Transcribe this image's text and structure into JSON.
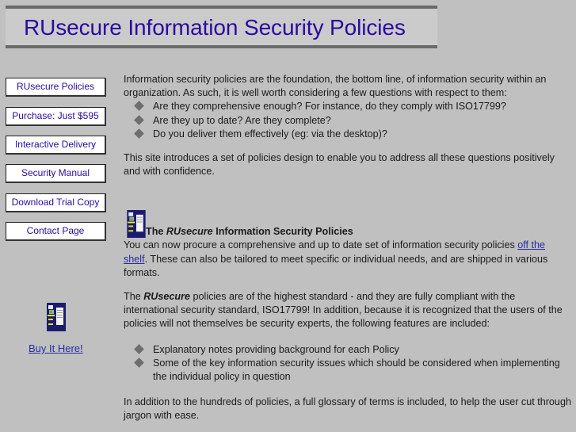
{
  "header": {
    "title": "RUsecure Information Security Policies"
  },
  "sidebar": {
    "nav": [
      {
        "label": "RUsecure Policies"
      },
      {
        "label": "Purchase: Just $595"
      },
      {
        "label": "Interactive Delivery"
      },
      {
        "label": "Security Manual"
      },
      {
        "label": "Download Trial Copy"
      },
      {
        "label": "Contact Page"
      }
    ],
    "book_icon": "book-cover-icon",
    "buy_link": "Buy It Here!"
  },
  "main": {
    "intro": "Information security policies are the foundation, the bottom line, of information security within an organization. As such, it is well worth considering a few questions with respect to them:",
    "questions": [
      "Are they comprehensive enough?  For instance, do they comply with ISO17799?",
      "Are they up to date? Are they complete?",
      "Do you deliver them effectively (eg: via the desktop)?"
    ],
    "site_intro": "This site introduces a set of policies design to enable you to address all these questions positively and with confidence.",
    "section_heading": {
      "prefix": "The ",
      "brand": "RUsecure",
      "suffix": " Information Security Policies"
    },
    "procure": {
      "before": "You can now procure a comprehensive and up to date set of information security policies ",
      "link": "off the shelf",
      "after": ". These can also be tailored to meet specific or individual needs, and are shipped in various formats."
    },
    "standard": {
      "prefix": "The ",
      "brand": "RUsecure",
      "text": " policies are of the highest standard - and they are fully compliant with the international security standard, ISO17799! In addition, because it is recognized that the users of the policies will not themselves be security experts, the following features are included:"
    },
    "features": [
      "Explanatory notes providing background for each Policy",
      "Some of the key information security issues which should be considered when implementing the individual policy in question"
    ],
    "glossary": "In addition to the hundreds of policies, a full glossary of terms is included, to help the user cut through jargon with ease."
  },
  "colors": {
    "background": "#c0c0c0",
    "title": "#2a0aa0",
    "link": "#2a2aa0",
    "banner_rule": "#6a6a6a",
    "bullet": "#6e6e6e"
  }
}
